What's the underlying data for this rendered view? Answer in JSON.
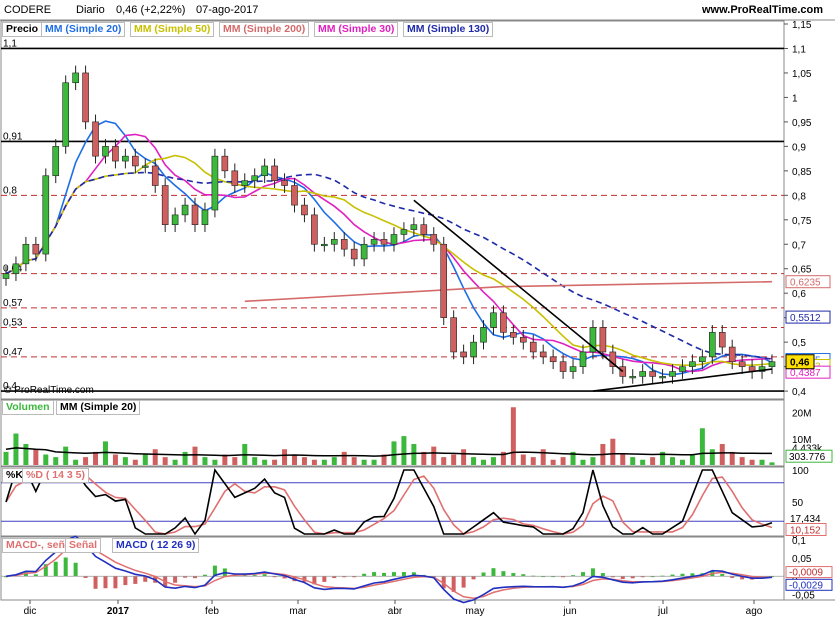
{
  "header": {
    "instrument": "CODERE",
    "period": "Diario",
    "quote": "0,46 (+2,22%)",
    "date": "07-ago-2017",
    "site": "www.ProRealTime.com",
    "copyright": "© ProRealTime.com"
  },
  "colors": {
    "mm20": "#1e6ee6",
    "mm50": "#c8c000",
    "mm200": "#d46a6a",
    "mm30": "#e020c0",
    "mm130": "#1e2aa8",
    "up": "#3cb83c",
    "down": "#d06060",
    "k": "#000000",
    "d": "#e07070",
    "signal": "#e07070",
    "macd_line": "#2030c0"
  },
  "chart_data": [
    {
      "type": "candlestick",
      "panel": "Precio",
      "legend": [
        "Precio",
        "MM (Simple 20)",
        "MM (Simple 50)",
        "MM (Simple 200)",
        "MM (Simple 30)",
        "MM (Simple 130)"
      ],
      "y_ticks": [
        "1,15",
        "1,1",
        "1,05",
        "1",
        "0,95",
        "0,9",
        "0,85",
        "0,8",
        "0,75",
        "0,7",
        "0,65",
        "0,6",
        "0,55",
        "0,5",
        "0,45",
        "0,4"
      ],
      "ylim": [
        0.39,
        1.15
      ],
      "x_ticks": [
        "dic",
        "2017",
        "feb",
        "mar",
        "abr",
        "may",
        "jun",
        "jul",
        "ago"
      ],
      "left_labels": [
        "1,1",
        "0,91",
        "0,8",
        "0,64",
        "0,57",
        "0,53",
        "0,47",
        "0,4"
      ],
      "h_lines": [
        1.1,
        0.91,
        0.4
      ],
      "dashed_levels": [
        0.8,
        0.64,
        0.57,
        0.53,
        0.47
      ],
      "ma200_value": "0,6235",
      "ma130_value": "0,5512",
      "ma20_value": "0,4645",
      "ma50_value": "0,4523",
      "ma30_value": "0,4387",
      "last_price": "0,46",
      "closes": [
        0.64,
        0.66,
        0.7,
        0.68,
        0.84,
        0.9,
        1.03,
        1.05,
        0.95,
        0.88,
        0.9,
        0.87,
        0.88,
        0.86,
        0.86,
        0.82,
        0.74,
        0.76,
        0.78,
        0.74,
        0.77,
        0.88,
        0.85,
        0.82,
        0.83,
        0.84,
        0.86,
        0.83,
        0.82,
        0.78,
        0.76,
        0.7,
        0.7,
        0.71,
        0.69,
        0.67,
        0.7,
        0.71,
        0.7,
        0.72,
        0.73,
        0.74,
        0.72,
        0.7,
        0.55,
        0.48,
        0.47,
        0.5,
        0.53,
        0.56,
        0.52,
        0.51,
        0.5,
        0.48,
        0.47,
        0.46,
        0.44,
        0.45,
        0.48,
        0.53,
        0.48,
        0.45,
        0.43,
        0.43,
        0.44,
        0.43,
        0.43,
        0.44,
        0.45,
        0.46,
        0.47,
        0.52,
        0.49,
        0.46,
        0.45,
        0.44,
        0.45,
        0.46
      ]
    },
    {
      "type": "bar",
      "panel": "Volumen",
      "legend": [
        "Volumen",
        "MM (Simple 20)"
      ],
      "y_ticks": [
        "20M",
        "10M"
      ],
      "ma_value": "4.433k",
      "last_value": "303.776",
      "values": [
        5,
        12,
        8,
        6,
        4,
        3,
        7,
        2,
        3,
        5,
        9,
        4,
        3,
        2,
        4,
        6,
        3,
        2,
        5,
        7,
        3,
        2,
        4,
        3,
        8,
        3,
        2,
        2,
        6,
        4,
        3,
        2,
        2,
        3,
        5,
        3,
        2,
        2,
        4,
        9,
        11,
        8,
        5,
        7,
        3,
        4,
        6,
        3,
        2,
        3,
        5,
        22,
        4,
        3,
        6,
        2,
        3,
        5,
        2,
        3,
        8,
        10,
        4,
        3,
        2,
        3,
        5,
        3,
        2,
        4,
        14,
        6,
        8,
        5,
        3,
        2,
        2,
        1
      ],
      "ma_values": [
        6,
        6.5,
        6.3,
        6.0,
        5.8,
        5.0,
        4.8,
        4.6,
        4.5,
        4.6,
        4.8,
        4.7,
        4.5,
        4.3,
        4.2,
        4.1,
        4.0,
        3.9,
        3.8,
        3.9,
        3.8,
        3.7,
        3.6,
        3.7,
        3.9,
        3.8,
        3.7,
        3.6,
        3.7,
        3.8,
        3.7,
        3.6,
        3.5,
        3.5,
        3.6,
        3.6,
        3.5,
        3.4,
        3.5,
        3.9,
        4.2,
        4.4,
        4.5,
        4.6,
        4.5,
        4.4,
        4.3,
        4.2,
        4.1,
        4.0,
        4.0,
        4.8,
        4.9,
        4.8,
        4.7,
        4.5,
        4.3,
        4.2,
        4.0,
        3.9,
        4.0,
        4.3,
        4.3,
        4.2,
        4.1,
        4.0,
        4.1,
        4.0,
        3.9,
        3.9,
        4.4,
        4.5,
        4.6,
        4.6,
        4.5,
        4.5,
        4.4,
        4.4
      ]
    },
    {
      "type": "line",
      "panel": "%K",
      "legend": [
        "%K",
        "%D ( 14 3 5)"
      ],
      "y_ticks": [
        "100",
        "50",
        "0"
      ],
      "k_value": "17,434",
      "d_value": "10,152"
    },
    {
      "type": "line",
      "panel": "MACD",
      "legend": [
        "MACD-, señal",
        "Señal",
        "MACD ( 12 26 9)"
      ],
      "y_ticks": [
        "0,1",
        "0,05",
        "0",
        "-0,05"
      ],
      "signal_value": "-0,0009",
      "macd_value": "-0,0029"
    }
  ]
}
